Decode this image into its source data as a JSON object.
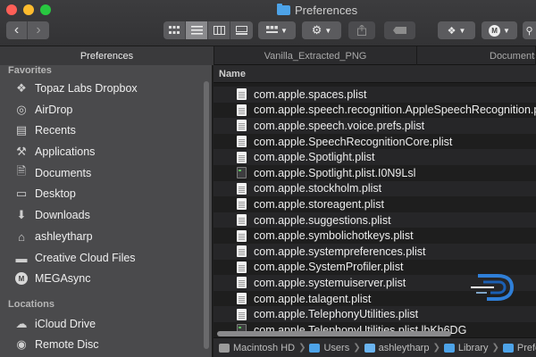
{
  "window": {
    "title": "Preferences",
    "colors": {
      "accent": "#4da3e8",
      "sidebar_bg": "#4a4a4c",
      "list_bg": "#1e1e1e",
      "toolbar_bg": "#3a3a3c"
    }
  },
  "toolbar": {
    "nav_back_icon": "chevron-left-icon",
    "nav_forward_icon": "chevron-right-icon",
    "view_modes": [
      "icon-view-icon",
      "list-view-icon",
      "column-view-icon",
      "gallery-view-icon"
    ],
    "active_view": "list-view-icon",
    "group_icon": "group-by-icon",
    "action_icon": "gear-icon",
    "share_icon": "share-icon",
    "tag_icon": "tag-icon",
    "dropbox_icon": "dropbox-icon",
    "mega_icon": "mega-icon",
    "search_icon": "search-icon"
  },
  "tabs": [
    {
      "label": "Preferences",
      "active": true
    },
    {
      "label": "Vanilla_Extracted_PNG",
      "active": false
    },
    {
      "label": "Documents",
      "active": false
    }
  ],
  "sidebar": {
    "favorites_header": "Favorites",
    "favorites": [
      {
        "label": "Topaz Labs Dropbox",
        "icon": "dropbox-icon"
      },
      {
        "label": "AirDrop",
        "icon": "airdrop-icon"
      },
      {
        "label": "Recents",
        "icon": "recents-icon"
      },
      {
        "label": "Applications",
        "icon": "applications-icon"
      },
      {
        "label": "Documents",
        "icon": "documents-icon"
      },
      {
        "label": "Desktop",
        "icon": "desktop-icon"
      },
      {
        "label": "Downloads",
        "icon": "downloads-icon"
      },
      {
        "label": "ashleytharp",
        "icon": "home-icon"
      },
      {
        "label": "Creative Cloud Files",
        "icon": "folder-icon"
      },
      {
        "label": "MEGAsync",
        "icon": "mega-icon"
      }
    ],
    "locations_header": "Locations",
    "locations": [
      {
        "label": "iCloud Drive",
        "icon": "icloud-icon"
      },
      {
        "label": "Remote Disc",
        "icon": "disc-icon"
      }
    ]
  },
  "list": {
    "column_name": "Name",
    "files": [
      {
        "name": "com.apple.spaces.plist",
        "icon": "plist-file-icon"
      },
      {
        "name": "com.apple.speech.recognition.AppleSpeechRecognition.prefs",
        "icon": "plist-file-icon"
      },
      {
        "name": "com.apple.speech.voice.prefs.plist",
        "icon": "plist-file-icon"
      },
      {
        "name": "com.apple.SpeechRecognitionCore.plist",
        "icon": "plist-file-icon"
      },
      {
        "name": "com.apple.Spotlight.plist",
        "icon": "plist-file-icon"
      },
      {
        "name": "com.apple.Spotlight.plist.I0N9Lsl",
        "icon": "exec-file-icon"
      },
      {
        "name": "com.apple.stockholm.plist",
        "icon": "plist-file-icon"
      },
      {
        "name": "com.apple.storeagent.plist",
        "icon": "plist-file-icon"
      },
      {
        "name": "com.apple.suggestions.plist",
        "icon": "plist-file-icon"
      },
      {
        "name": "com.apple.symbolichotkeys.plist",
        "icon": "plist-file-icon"
      },
      {
        "name": "com.apple.systempreferences.plist",
        "icon": "plist-file-icon"
      },
      {
        "name": "com.apple.SystemProfiler.plist",
        "icon": "plist-file-icon"
      },
      {
        "name": "com.apple.systemuiserver.plist",
        "icon": "plist-file-icon"
      },
      {
        "name": "com.apple.talagent.plist",
        "icon": "plist-file-icon"
      },
      {
        "name": "com.apple.TelephonyUtilities.plist",
        "icon": "plist-file-icon"
      },
      {
        "name": "com.apple.TelephonyUtilities.plist.lbKh6DG",
        "icon": "exec-file-icon"
      }
    ]
  },
  "pathbar": [
    "Macintosh HD",
    "Users",
    "ashleytharp",
    "Library",
    "Prefe"
  ]
}
